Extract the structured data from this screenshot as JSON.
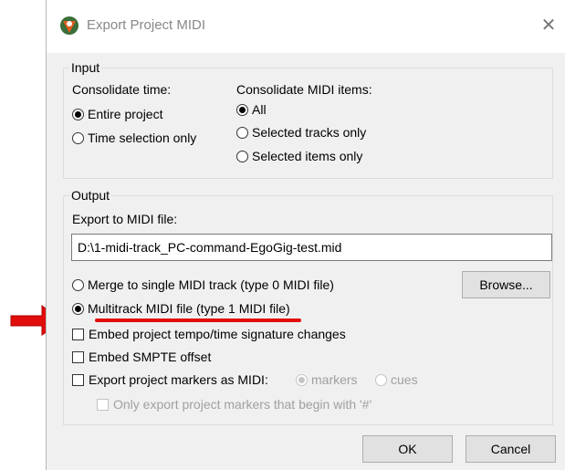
{
  "dialog": {
    "title": "Export Project MIDI",
    "close_glyph": "✕",
    "icon_name": "reaper-logo-icon"
  },
  "input": {
    "legend": "Input",
    "consolidate_time": {
      "label": "Consolidate time:",
      "options": [
        {
          "label": "Entire project",
          "checked": true
        },
        {
          "label": "Time selection only",
          "checked": false
        }
      ]
    },
    "consolidate_items": {
      "label": "Consolidate MIDI items:",
      "options": [
        {
          "label": "All",
          "checked": true
        },
        {
          "label": "Selected tracks only",
          "checked": false
        },
        {
          "label": "Selected items only",
          "checked": false
        }
      ]
    }
  },
  "output": {
    "legend": "Output",
    "file_label": "Export to MIDI file:",
    "file_value": "D:\\1-midi-track_PC-command-EgoGig-test.mid",
    "browse_label": "Browse...",
    "format_options": [
      {
        "label": "Merge to single MIDI track (type 0 MIDI file)",
        "checked": false
      },
      {
        "label": "Multitrack MIDI file (type 1 MIDI file)",
        "checked": true
      }
    ],
    "checkboxes": [
      {
        "label": "Embed project tempo/time signature changes",
        "checked": false
      },
      {
        "label": "Embed SMPTE offset",
        "checked": false
      },
      {
        "label": "Export project markers as MIDI:",
        "checked": false
      }
    ],
    "marker_modes": [
      {
        "label": "markers",
        "checked": true,
        "enabled": false
      },
      {
        "label": "cues",
        "checked": false,
        "enabled": false
      }
    ],
    "hash_only_label": "Only export project markers that begin with '#'"
  },
  "buttons": {
    "ok": "OK",
    "cancel": "Cancel"
  },
  "annotation": {
    "color": "#e10d0d",
    "arrow_icon": "red-arrow-icon"
  }
}
